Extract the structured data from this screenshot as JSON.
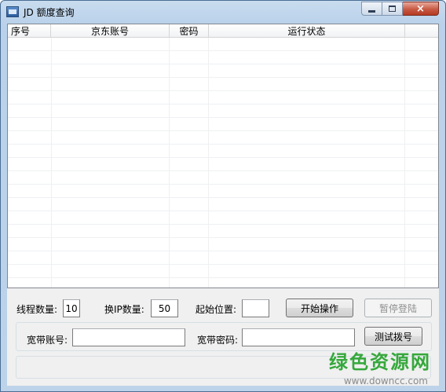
{
  "window": {
    "title": "JD 额度查询",
    "icon": "app-window-icon",
    "controls": {
      "minimize": "minimize-icon",
      "maximize": "maximize-icon",
      "close": "×"
    }
  },
  "list": {
    "columns": [
      "序号",
      "京东账号",
      "密码",
      "运行状态",
      ""
    ],
    "rows": []
  },
  "settings": {
    "thread_label": "线程数量:",
    "thread_value": "10",
    "ip_label": "换IP数量:",
    "ip_value": "50",
    "start_pos_label": "起始位置:",
    "start_pos_value": "",
    "start_button": "开始操作",
    "pause_button": "暂停登陆"
  },
  "broadband": {
    "account_label": "宽带账号:",
    "account_value": "",
    "password_label": "宽带密码:",
    "password_value": "",
    "test_button": "测试拨号"
  },
  "status": {
    "text": ""
  },
  "watermark": {
    "brand": "绿色资源网",
    "url": "www.downcc.com",
    "color": "#35a83c"
  }
}
